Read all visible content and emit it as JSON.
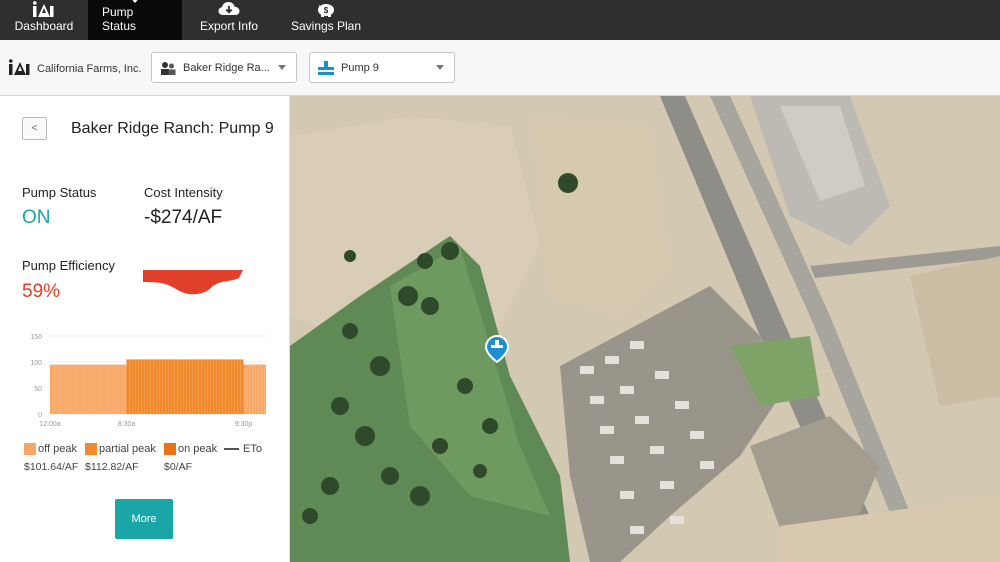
{
  "nav": {
    "items": [
      {
        "label": "Dashboard",
        "icon": "logo-icon",
        "active": false
      },
      {
        "label": "Pump Status",
        "icon": "map-pin-icon",
        "active": true
      },
      {
        "label": "Export Info",
        "icon": "cloud-download-icon",
        "active": false
      },
      {
        "label": "Savings Plan",
        "icon": "piggy-bank-icon",
        "active": false
      }
    ]
  },
  "toolbar": {
    "company": "California Farms, Inc.",
    "farm_select": {
      "value": "Baker Ridge Ra...",
      "icon": "farm-icon"
    },
    "pump_select": {
      "value": "Pump 9",
      "icon": "pump-icon"
    }
  },
  "panel": {
    "back_label": "<",
    "title": "Baker Ridge Ranch: Pump 9",
    "pump_status_label": "Pump Status",
    "pump_status_value": "ON",
    "cost_intensity_label": "Cost Intensity",
    "cost_intensity_value": "-$274/AF",
    "efficiency_label": "Pump Efficiency",
    "efficiency_value": "59%",
    "more_label": "More"
  },
  "colors": {
    "accent_teal": "#1aa5a8",
    "status_on": "#1aa5a8",
    "efficiency_red": "#e0402a",
    "off_peak": "#f7a866",
    "partial_peak": "#f08a2c",
    "on_peak": "#ea7412",
    "nav_bg": "#2f2f2f"
  },
  "chart_data": {
    "type": "bar",
    "ylim": [
      0,
      150
    ],
    "yticks": [
      "150",
      "100",
      "50",
      "0"
    ],
    "xticks": [
      "12:00a",
      "8:30a",
      "9:30p"
    ],
    "series": [
      {
        "name": "off peak",
        "start": "12:00a",
        "end": "8:30a",
        "value": 95
      },
      {
        "name": "partial peak",
        "start": "8:30a",
        "end": "9:30p",
        "value": 105
      },
      {
        "name": "off peak",
        "start": "9:30p",
        "end": "12:00a",
        "value": 95
      }
    ],
    "legend": [
      {
        "label": "off peak",
        "cost": "$101.64/AF"
      },
      {
        "label": "partial peak",
        "cost": "$112.82/AF"
      },
      {
        "label": "on peak",
        "cost": "$0/AF"
      },
      {
        "label": "ETo",
        "cost": ""
      }
    ]
  }
}
